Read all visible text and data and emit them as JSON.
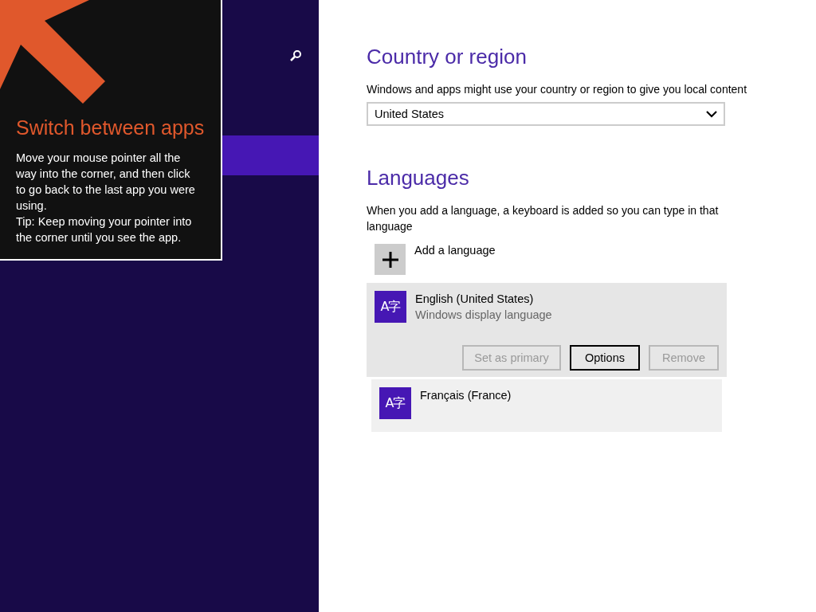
{
  "sidebar": {
    "items": [
      {
        "selected": true
      }
    ]
  },
  "tip": {
    "title": "Switch between apps",
    "body": "Move your mouse pointer all the way into the corner, and then click to go back to the last app you were using.",
    "tip": "Tip: Keep moving your pointer into the corner until you see the app."
  },
  "country": {
    "heading": "Country or region",
    "description": "Windows and apps might use your country or region to give you local content",
    "value": "United States"
  },
  "languages": {
    "heading": "Languages",
    "description": "When you add a language, a keyboard is added so you can type in that language",
    "add_label": "Add a language",
    "items": [
      {
        "icon_text": "A字",
        "name": "English (United States)",
        "detail": "Windows display language",
        "selected": true,
        "buttons": [
          {
            "label": "Set as primary",
            "disabled": true,
            "focused": false
          },
          {
            "label": "Options",
            "disabled": false,
            "focused": true
          },
          {
            "label": "Remove",
            "disabled": true,
            "focused": false
          }
        ]
      },
      {
        "icon_text": "A字",
        "name": "Français (France)",
        "selected": false
      }
    ]
  }
}
